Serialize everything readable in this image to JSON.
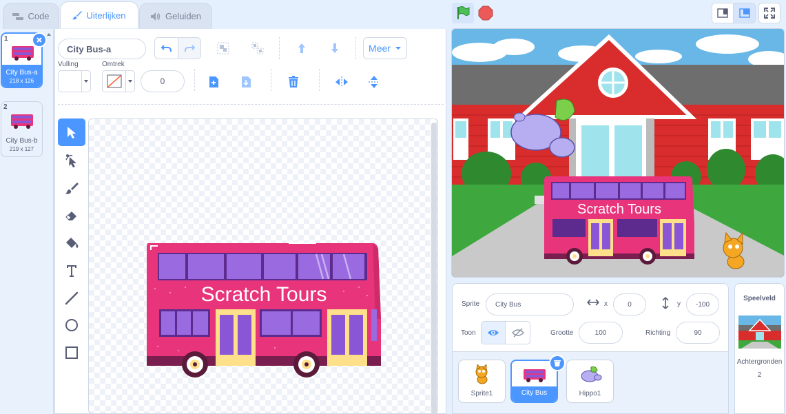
{
  "tabs": [
    {
      "label": "Code",
      "icon": "code-icon"
    },
    {
      "label": "Uiterlijken",
      "icon": "brush-icon"
    },
    {
      "label": "Geluiden",
      "icon": "speaker-icon"
    }
  ],
  "costumes": [
    {
      "num": "1",
      "name": "City Bus-a",
      "size": "218 x 126",
      "selected": true
    },
    {
      "num": "2",
      "name": "City Bus-b",
      "size": "219 x 127",
      "selected": false
    }
  ],
  "editor": {
    "costume_name": "City Bus-a",
    "fill_label": "Vulling",
    "outline_label": "Omtrek",
    "outline_width": "0",
    "more_label": "Meer"
  },
  "canvas": {
    "bus_text": "Scratch Tours"
  },
  "stage": {
    "bus_text": "Scratch Tours"
  },
  "sprite_info": {
    "sprite_label": "Sprite",
    "sprite_name": "City Bus",
    "x_label": "x",
    "x_value": "0",
    "y_label": "y",
    "y_value": "-100",
    "show_label": "Toon",
    "size_label": "Grootte",
    "size_value": "100",
    "direction_label": "Richting",
    "direction_value": "90"
  },
  "sprites": [
    {
      "name": "Sprite1",
      "selected": false
    },
    {
      "name": "City Bus",
      "selected": true
    },
    {
      "name": "Hippo1",
      "selected": false
    }
  ],
  "stage_panel": {
    "title": "Speelveld",
    "backdrops_label": "Achtergronden",
    "backdrops_count": "2"
  },
  "colors": {
    "accent": "#4c97ff",
    "bus_pink": "#e8347b",
    "bus_window": "#8b56d6",
    "stop": "#ec5959",
    "flag": "#4cbf56"
  }
}
